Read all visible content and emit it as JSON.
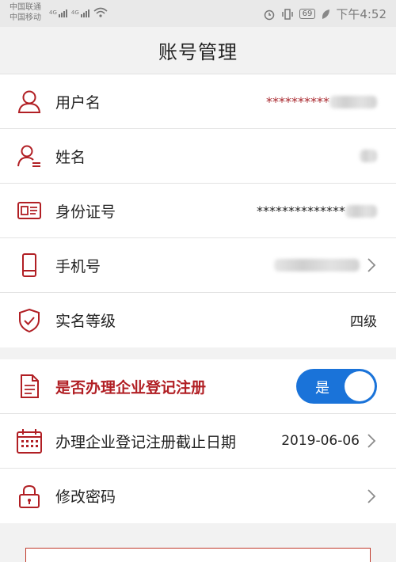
{
  "status_bar": {
    "carrier1": "中国联通",
    "carrier2": "中国移动",
    "net1": "4G",
    "net2": "4G",
    "battery": "69",
    "time": "下午4:52"
  },
  "header": {
    "title": "账号管理"
  },
  "account": [
    {
      "label": "用户名",
      "value": "**********",
      "icon": "user-icon"
    },
    {
      "label": "姓名",
      "value": "",
      "icon": "person-card-icon"
    },
    {
      "label": "身份证号",
      "value": "**************",
      "icon": "id-card-icon"
    },
    {
      "label": "手机号",
      "value": "",
      "icon": "phone-icon"
    },
    {
      "label": "实名等级",
      "value": "四级",
      "icon": "shield-check-icon"
    }
  ],
  "registration": {
    "question": "是否办理企业登记注册",
    "toggle_label": "是",
    "toggle_on": true,
    "deadline_label": "办理企业登记注册截止日期",
    "deadline_value": "2019-06-06",
    "password_label": "修改密码"
  },
  "colors": {
    "accent": "#b11f24",
    "toggle": "#1a73d9"
  }
}
